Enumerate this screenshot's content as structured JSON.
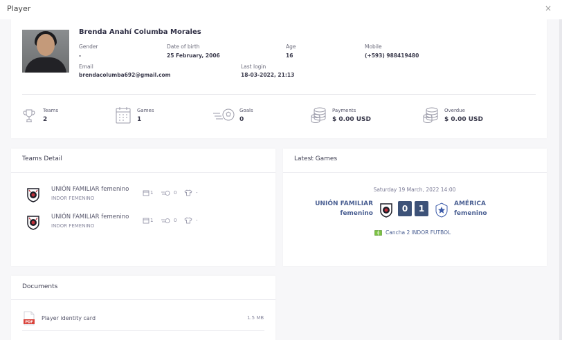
{
  "modal": {
    "title": "Player",
    "close_icon": "×"
  },
  "player": {
    "name": "Brenda Anahí Columba Morales",
    "fields": {
      "gender_label": "Gender",
      "gender_value": "-",
      "dob_label": "Date of birth",
      "dob_value": "25 February, 2006",
      "age_label": "Age",
      "age_value": "16",
      "mobile_label": "Mobile",
      "mobile_value": "(+593) 988419480",
      "email_label": "Email",
      "email_value": "brendacolumba692@gmail.com",
      "login_label": "Last login",
      "login_value": "18-03-2022, 21:13"
    }
  },
  "stats": [
    {
      "label": "Teams",
      "value": "2",
      "icon": "trophy-icon"
    },
    {
      "label": "Games",
      "value": "1",
      "icon": "calendar-icon"
    },
    {
      "label": "Goals",
      "value": "0",
      "icon": "ball-icon"
    },
    {
      "label": "Payments",
      "value": "$ 0.00 USD",
      "icon": "coins-icon"
    },
    {
      "label": "Overdue",
      "value": "$ 0.00 USD",
      "icon": "coins-icon"
    }
  ],
  "teams_detail": {
    "title": "Teams Detail",
    "items": [
      {
        "name": "UNIÓN FAMILIAR femenino",
        "category": "INDOR FEMENINO",
        "games": "1",
        "goals": "0",
        "number": "-"
      },
      {
        "name": "UNIÓN FAMILIAR femenino",
        "category": "INDOR FEMENINO",
        "games": "1",
        "goals": "0",
        "number": "-"
      }
    ]
  },
  "latest_games": {
    "title": "Latest Games",
    "date": "Saturday 19 March, 2022 14:00",
    "home_line1": "UNIÓN FAMILIAR",
    "home_line2": "femenino",
    "home_score": "0",
    "away_score": "1",
    "away_line1": "AMÉRICA",
    "away_line2": "femenino",
    "venue": "Cancha 2 INDOR FUTBOL"
  },
  "documents": {
    "title": "Documents",
    "items": [
      {
        "name": "Player identity card",
        "size": "1.5 MB",
        "icon": "pdf-icon",
        "badge": "PDF"
      }
    ]
  },
  "colors": {
    "accent": "#3d5278",
    "link": "#4a5f92",
    "background": "#f7f7f9"
  }
}
